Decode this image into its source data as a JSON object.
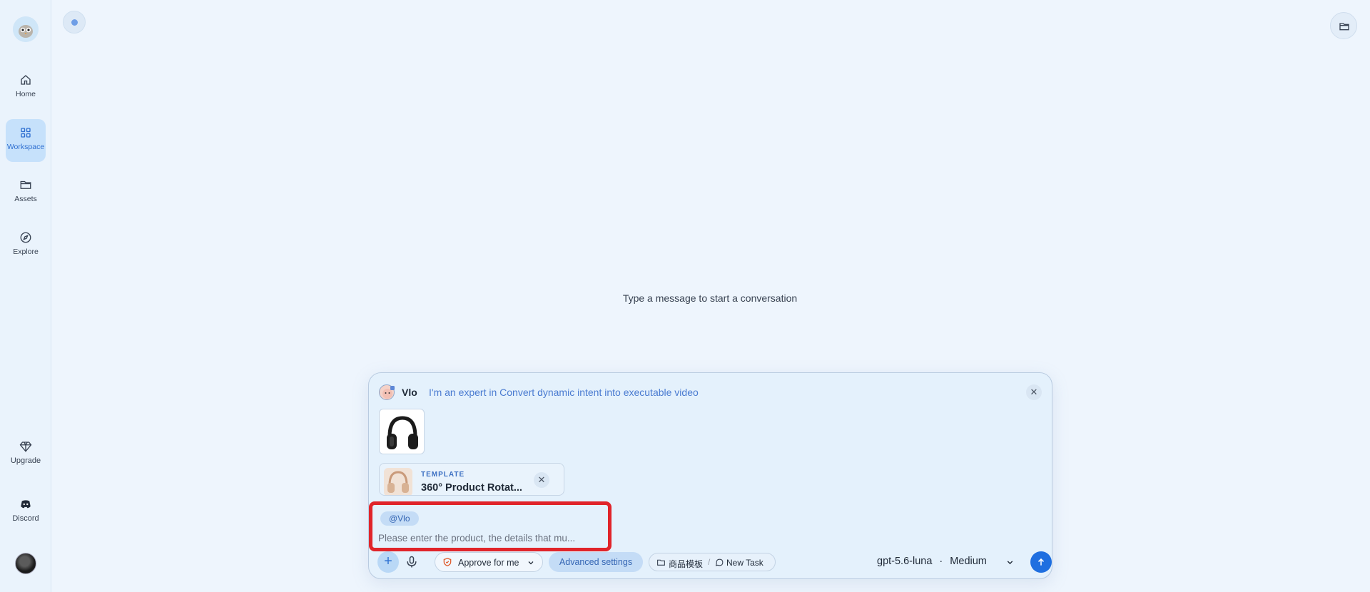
{
  "sidebar": {
    "items": [
      {
        "label": "Home",
        "icon": "home-icon"
      },
      {
        "label": "Workspace",
        "icon": "grid-icon",
        "active": true
      },
      {
        "label": "Assets",
        "icon": "folder-icon"
      },
      {
        "label": "Explore",
        "icon": "compass-icon"
      }
    ],
    "bottom_items": [
      {
        "label": "Upgrade",
        "icon": "diamond-icon"
      },
      {
        "label": "Discord",
        "icon": "discord-icon"
      }
    ]
  },
  "main": {
    "empty_message": "Type a message to start a conversation"
  },
  "composer": {
    "agent_name": "Vlo",
    "agent_description": "I'm an expert in Convert dynamic intent into executable video",
    "template": {
      "tag": "TEMPLATE",
      "title": "360° Product Rotat..."
    },
    "mention": "@Vlo",
    "input_placeholder": "Please enter the product, the details that mu...",
    "approve_label": "Approve for me",
    "advanced_label": "Advanced settings",
    "context_template": "商品模板",
    "context_task": "New Task",
    "model": "gpt-5.6-luna",
    "model_separator": "·",
    "effort": "Medium"
  },
  "colors": {
    "accent": "#1f6fe0",
    "highlight_border": "#e0242a",
    "background": "#eef5fd"
  }
}
